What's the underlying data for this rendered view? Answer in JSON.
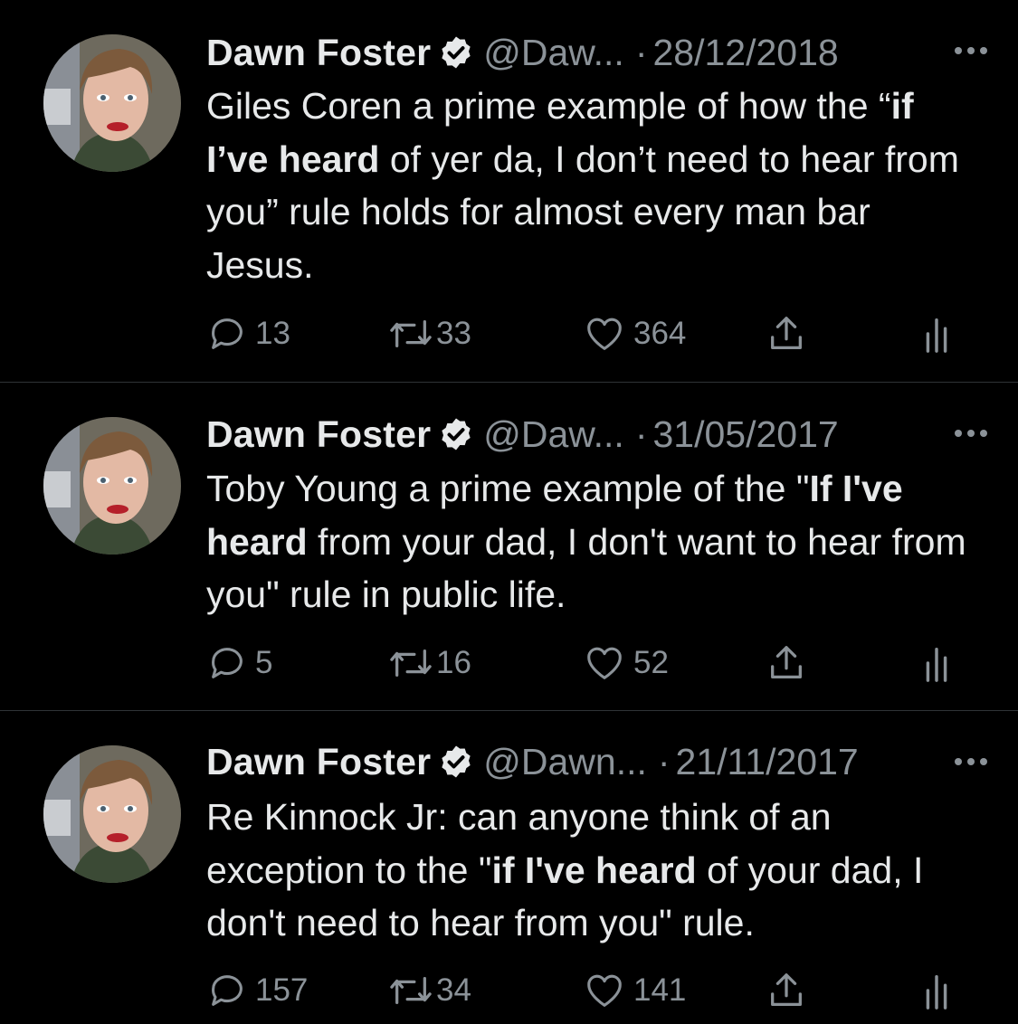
{
  "colors": {
    "background": "#000000",
    "text_primary": "#e7e9ea",
    "text_secondary": "#8b9298",
    "divider": "#2f3336",
    "verified_badge": "#e7e9ea"
  },
  "icons": {
    "reply": "speech-bubble-icon",
    "retweet": "retweet-arrows-icon",
    "like": "heart-icon",
    "share": "share-upload-icon",
    "analytics": "bar-chart-icon",
    "more": "ellipsis-icon",
    "verified": "verified-badge-icon"
  },
  "tweets": [
    {
      "name": "Dawn Foster",
      "handle": "@Daw...",
      "separator": "·",
      "date": "28/12/2018",
      "text_parts": [
        {
          "t": "Giles Coren a prime example of how the “",
          "bold": false
        },
        {
          "t": "if I’ve heard",
          "bold": true
        },
        {
          "t": " of yer da, I don’t need to hear from you” rule holds for almost every man bar Jesus.",
          "bold": false
        }
      ],
      "replies": "13",
      "retweets": "33",
      "likes": "364"
    },
    {
      "name": "Dawn Foster",
      "handle": "@Daw...",
      "separator": "·",
      "date": "31/05/2017",
      "text_parts": [
        {
          "t": "Toby Young a prime example of the \"",
          "bold": false
        },
        {
          "t": "If I've heard",
          "bold": true
        },
        {
          "t": " from your dad, I don't want to hear from you\" rule in public life.",
          "bold": false
        }
      ],
      "replies": "5",
      "retweets": "16",
      "likes": "52"
    },
    {
      "name": "Dawn Foster",
      "handle": "@Dawn...",
      "separator": "·",
      "date": "21/11/2017",
      "text_parts": [
        {
          "t": "Re Kinnock Jr: can anyone think of an exception to the \"",
          "bold": false
        },
        {
          "t": "if I've heard",
          "bold": true
        },
        {
          "t": " of your dad, I don't need to hear from you\" rule.",
          "bold": false
        }
      ],
      "replies": "157",
      "retweets": "34",
      "likes": "141"
    }
  ]
}
